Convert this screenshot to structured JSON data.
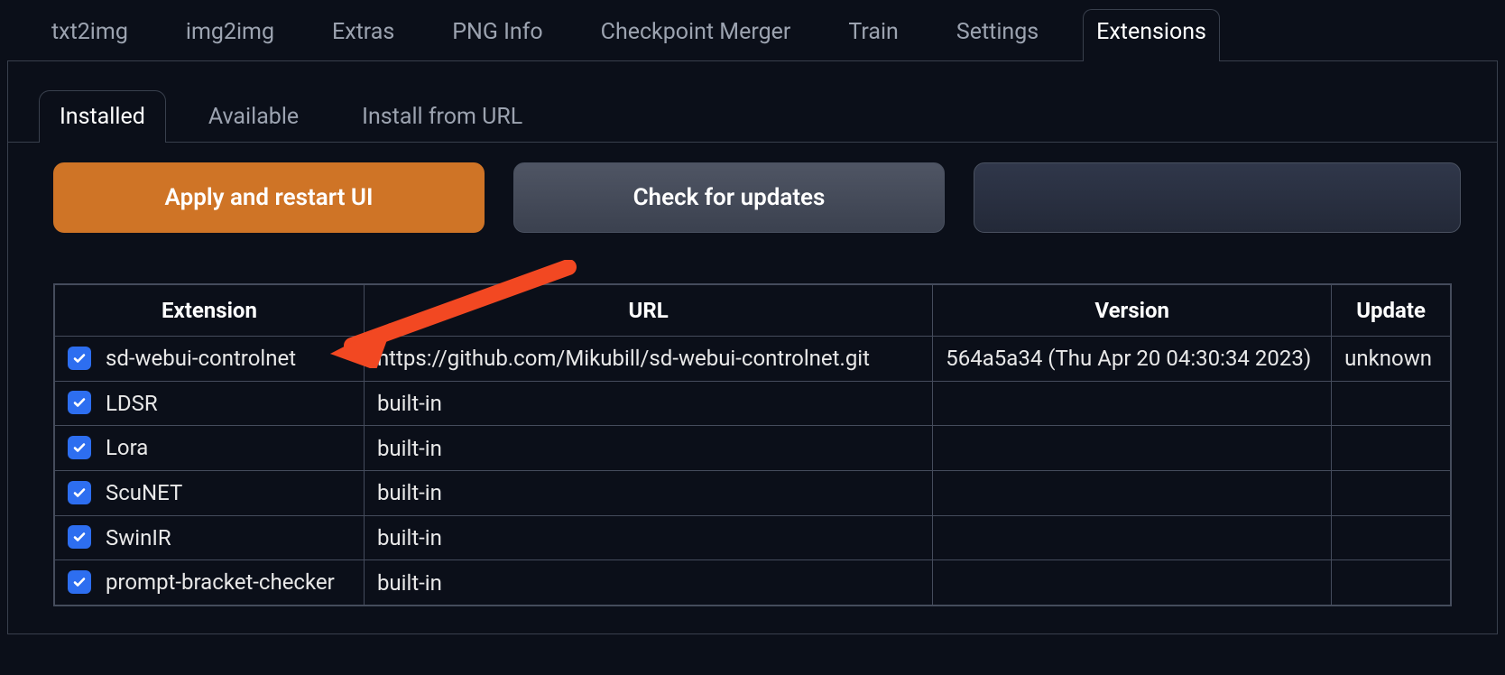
{
  "main_tabs": {
    "items": [
      {
        "label": "txt2img"
      },
      {
        "label": "img2img"
      },
      {
        "label": "Extras"
      },
      {
        "label": "PNG Info"
      },
      {
        "label": "Checkpoint Merger"
      },
      {
        "label": "Train"
      },
      {
        "label": "Settings"
      },
      {
        "label": "Extensions"
      }
    ],
    "active_index": 7
  },
  "sub_tabs": {
    "items": [
      {
        "label": "Installed"
      },
      {
        "label": "Available"
      },
      {
        "label": "Install from URL"
      }
    ],
    "active_index": 0
  },
  "actions": {
    "apply_restart": "Apply and restart UI",
    "check_updates": "Check for updates"
  },
  "table": {
    "headers": {
      "extension": "Extension",
      "url": "URL",
      "version": "Version",
      "update": "Update"
    },
    "rows": [
      {
        "checked": true,
        "name": "sd-webui-controlnet",
        "url": "https://github.com/Mikubill/sd-webui-controlnet.git",
        "version": "564a5a34 (Thu Apr 20 04:30:34 2023)",
        "update": "unknown"
      },
      {
        "checked": true,
        "name": "LDSR",
        "url": "built-in",
        "version": "",
        "update": ""
      },
      {
        "checked": true,
        "name": "Lora",
        "url": "built-in",
        "version": "",
        "update": ""
      },
      {
        "checked": true,
        "name": "ScuNET",
        "url": "built-in",
        "version": "",
        "update": ""
      },
      {
        "checked": true,
        "name": "SwinIR",
        "url": "built-in",
        "version": "",
        "update": ""
      },
      {
        "checked": true,
        "name": "prompt-bracket-checker",
        "url": "built-in",
        "version": "",
        "update": ""
      }
    ]
  },
  "colors": {
    "accent_orange": "#cf7426",
    "checkbox_blue": "#2d6ef0",
    "arrow_red": "#f24822"
  }
}
